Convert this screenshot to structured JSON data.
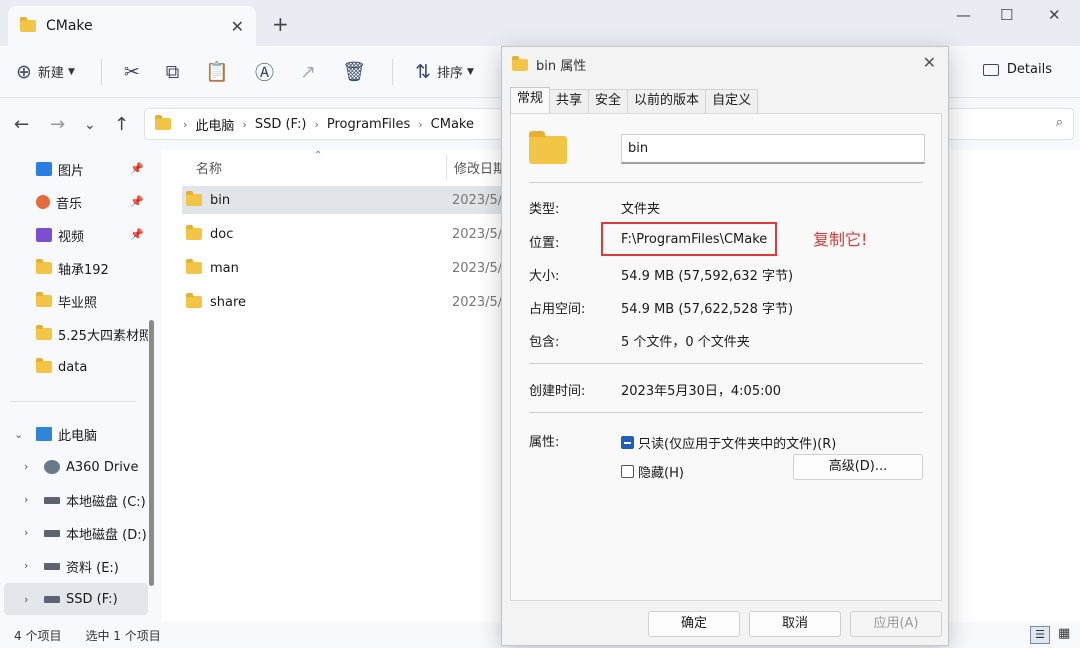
{
  "window": {
    "tab_title": "CMake",
    "new_label": "新建",
    "sort_label": "排序",
    "details_label": "Details"
  },
  "breadcrumb": [
    "此电脑",
    "SSD (F:)",
    "ProgramFiles",
    "CMake"
  ],
  "sidebar": {
    "quick": [
      {
        "label": "图片",
        "icon": "pictures-icon",
        "color": "#2a7de1",
        "pinned": true
      },
      {
        "label": "音乐",
        "icon": "music-icon",
        "color": "#e46b3a",
        "pinned": true
      },
      {
        "label": "视频",
        "icon": "videos-icon",
        "color": "#7a4fd0",
        "pinned": true
      },
      {
        "label": "轴承192",
        "icon": "folder-icon"
      },
      {
        "label": "毕业照",
        "icon": "folder-icon"
      },
      {
        "label": "5.25大四素材照",
        "icon": "folder-icon"
      },
      {
        "label": "data",
        "icon": "folder-icon"
      }
    ],
    "this_pc": "此电脑",
    "drives": [
      {
        "label": "A360 Drive"
      },
      {
        "label": "本地磁盘 (C:)"
      },
      {
        "label": "本地磁盘 (D:)"
      },
      {
        "label": "资料 (E:)"
      },
      {
        "label": "SSD (F:)"
      }
    ]
  },
  "columns": {
    "name": "名称",
    "modified": "修改日期"
  },
  "files": [
    {
      "name": "bin",
      "date": "2023/5/"
    },
    {
      "name": "doc",
      "date": "2023/5/"
    },
    {
      "name": "man",
      "date": "2023/5/"
    },
    {
      "name": "share",
      "date": "2023/5/"
    }
  ],
  "status": {
    "count": "4 个项目",
    "selected": "选中 1 个项目"
  },
  "dialog": {
    "title": "bin 属性",
    "tabs": [
      "常规",
      "共享",
      "安全",
      "以前的版本",
      "自定义"
    ],
    "folder_name": "bin",
    "type_label": "类型:",
    "type_value": "文件夹",
    "location_label": "位置:",
    "location_value": "F:\\ProgramFiles\\CMake",
    "annotation": "复制它!",
    "size_label": "大小:",
    "size_value": "54.9 MB (57,592,632 字节)",
    "disk_label": "占用空间:",
    "disk_value": "54.9 MB (57,622,528 字节)",
    "contains_label": "包含:",
    "contains_value": "5 个文件，0 个文件夹",
    "created_label": "创建时间:",
    "created_value": "2023年5月30日，4:05:00",
    "attr_label": "属性:",
    "readonly_label": "只读(仅应用于文件夹中的文件)(R)",
    "hidden_label": "隐藏(H)",
    "advanced_label": "高级(D)...",
    "ok_label": "确定",
    "cancel_label": "取消",
    "apply_label": "应用(A)"
  }
}
